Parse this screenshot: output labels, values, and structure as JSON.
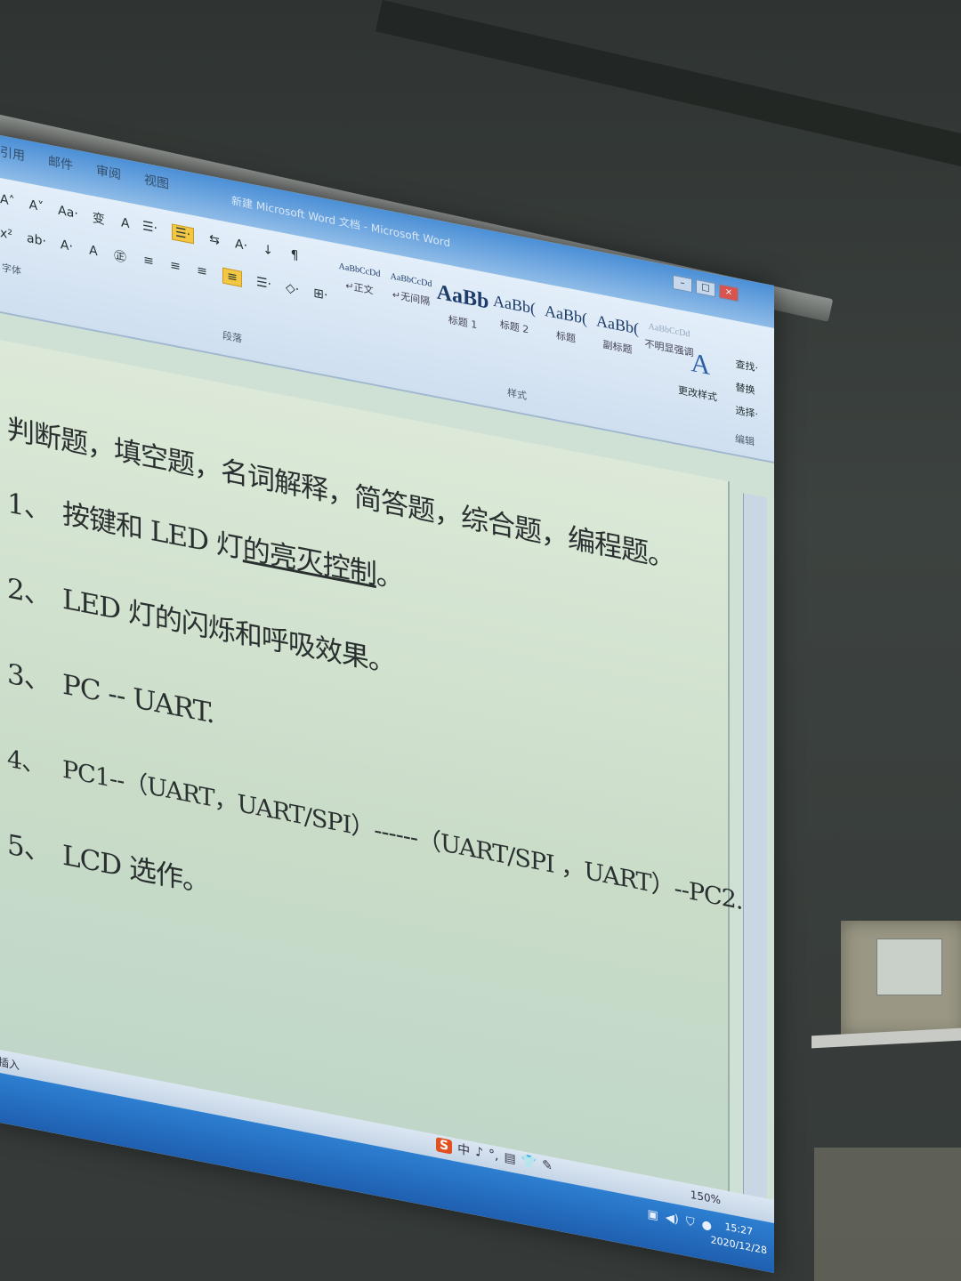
{
  "window": {
    "title": "新建 Microsoft Word 文档 - Microsoft Word",
    "tabs": [
      "引用",
      "邮件",
      "审阅",
      "视图"
    ],
    "controls": [
      "–",
      "□",
      "×"
    ]
  },
  "ribbon": {
    "font_row1": [
      "A˄",
      "A˅",
      "Aa·",
      "变",
      "A"
    ],
    "font_row2": [
      "x²",
      "ab·",
      "A·",
      "A",
      "㊣"
    ],
    "para_row1": [
      "☰·",
      "☰·",
      "⇆",
      "A·",
      "↓",
      "¶"
    ],
    "para_row2": [
      "≡",
      "≡",
      "≡",
      "≡",
      "☰·",
      "◇·",
      "⊞·"
    ],
    "font_group_label": "字体",
    "para_group_label": "段落",
    "styles_group_label": "样式",
    "edit_group_label": "编辑",
    "styles": [
      {
        "sample": "AaBbCcDd",
        "caption": "↵正文"
      },
      {
        "sample": "AaBbCcDd",
        "caption": "↵无间隔"
      },
      {
        "sample": "AaBb",
        "caption": "标题 1"
      },
      {
        "sample": "AaBb(",
        "caption": "标题 2"
      },
      {
        "sample": "AaBb(",
        "caption": "标题"
      },
      {
        "sample": "AaBb(",
        "caption": "副标题"
      },
      {
        "sample": "AaBbCcDd",
        "caption": "不明显强调"
      }
    ],
    "change_styles_label": "更改样式",
    "edit": {
      "find": "查找·",
      "replace": "替换",
      "select": "选择·"
    }
  },
  "document": {
    "intro": "判断题，填空题，名词解释，简答题，综合题，编程题。",
    "items": [
      {
        "num": "1、",
        "pre": "按键和 LED 灯",
        "underlined": "的亮灭控制",
        "post": "。"
      },
      {
        "num": "2、",
        "pre": "LED 灯的闪烁和呼吸效果。",
        "underlined": "",
        "post": ""
      },
      {
        "num": "3、",
        "pre": "PC -- UART.",
        "underlined": "",
        "post": ""
      },
      {
        "num": "4、",
        "pre": "PC1--（UART，UART/SPI）------（UART/SPI ，UART）--PC2.",
        "underlined": "",
        "post": ""
      },
      {
        "num": "5、",
        "pre": "LCD 选作。",
        "underlined": "",
        "post": ""
      }
    ]
  },
  "status": {
    "left": "插入",
    "ime_logo": "S",
    "ime_items": [
      "中",
      "♪",
      "°,",
      "▤",
      "👕",
      "✎"
    ],
    "zoom": "150%"
  },
  "taskbar": {
    "time": "15:27",
    "date": "2020/12/28"
  }
}
